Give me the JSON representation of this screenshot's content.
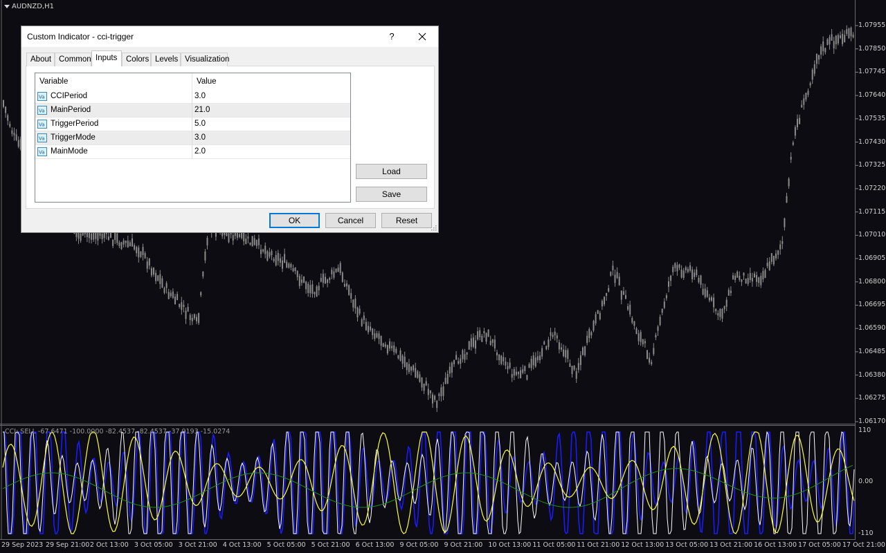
{
  "chart": {
    "symbol_label": "AUDNZD,H1",
    "indicator_label": "CCI: SELL -67.6471 -100.0000 -82.4537 -82.4537 -37.9193 -15.0274",
    "price_ticks": [
      "1.07955",
      "1.07850",
      "1.07745",
      "1.07640",
      "1.07535",
      "1.07430",
      "1.07325",
      "1.07220",
      "1.07115",
      "1.07010",
      "1.06905",
      "1.06800",
      "1.06695",
      "1.06590",
      "1.06485",
      "1.06380",
      "1.06275",
      "1.06170"
    ],
    "indicator_ticks": [
      "110",
      "0.00",
      "-110"
    ],
    "time_ticks": [
      "29 Sep 2023",
      "29 Sep 21:00",
      "2 Oct 13:00",
      "3 Oct 05:00",
      "3 Oct 21:00",
      "4 Oct 13:00",
      "5 Oct 05:00",
      "5 Oct 21:00",
      "6 Oct 13:00",
      "9 Oct 05:00",
      "9 Oct 21:00",
      "10 Oct 13:00",
      "11 Oct 05:00",
      "11 Oct 21:00",
      "12 Oct 13:00",
      "13 Oct 05:00",
      "13 Oct 21:00",
      "16 Oct 13:00",
      "17 Oct 05:00",
      "17 Oct 21:00"
    ],
    "colors": {
      "background": "#0c0c12",
      "candles": "#8c8c8c",
      "cci_fast": "#ffffff",
      "cci_blue": "#1a1aff",
      "cci_trigger": "#ffff33",
      "cci_main": "#1f8f1f"
    }
  },
  "dialog": {
    "title": "Custom Indicator - cci-trigger",
    "help_label": "?",
    "tabs": [
      {
        "label": "About"
      },
      {
        "label": "Common"
      },
      {
        "label": "Inputs"
      },
      {
        "label": "Colors"
      },
      {
        "label": "Levels"
      },
      {
        "label": "Visualization"
      }
    ],
    "active_tab": "Inputs",
    "grid": {
      "col_variable": "Variable",
      "col_value": "Value",
      "rows": [
        {
          "name": "CCIPeriod",
          "value": "3.0"
        },
        {
          "name": "MainPeriod",
          "value": "21.0"
        },
        {
          "name": "TriggerPeriod",
          "value": "5.0"
        },
        {
          "name": "TriggerMode",
          "value": "3.0"
        },
        {
          "name": "MainMode",
          "value": "2.0"
        }
      ]
    },
    "buttons": {
      "load": "Load",
      "save": "Save",
      "ok": "OK",
      "cancel": "Cancel",
      "reset": "Reset"
    }
  }
}
